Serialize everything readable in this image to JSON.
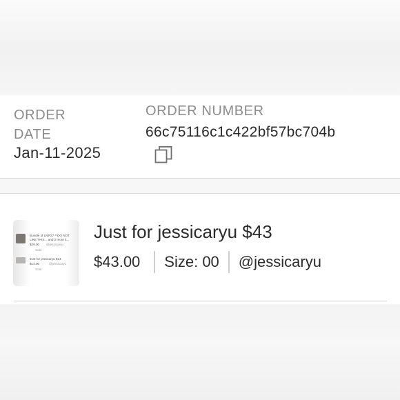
{
  "order": {
    "date_label": "ORDER DATE",
    "date_value": "Jan-11-2025",
    "number_label": "ORDER NUMBER",
    "number_value": "66c75116c1c422bf57bc704b",
    "copy_icon": "copy-icon"
  },
  "item": {
    "title": "Just for jessicaryu $43",
    "price": "$43.00",
    "size": "Size: 00",
    "seller": "@jessicaryu",
    "thumbnail": {
      "row1_title": "Bundle of LMP27 **DO NOT",
      "row1_title2": "LIKE THIS... and 2 more it...",
      "row1_price": "$29.00",
      "row1_user": "@jessicaryu",
      "row1_status": "Sold",
      "row2_title": "Just for jessicaryu $14",
      "row2_price": "$14.00",
      "row2_user": "@jessicaryu",
      "row2_status": "Sold"
    }
  }
}
